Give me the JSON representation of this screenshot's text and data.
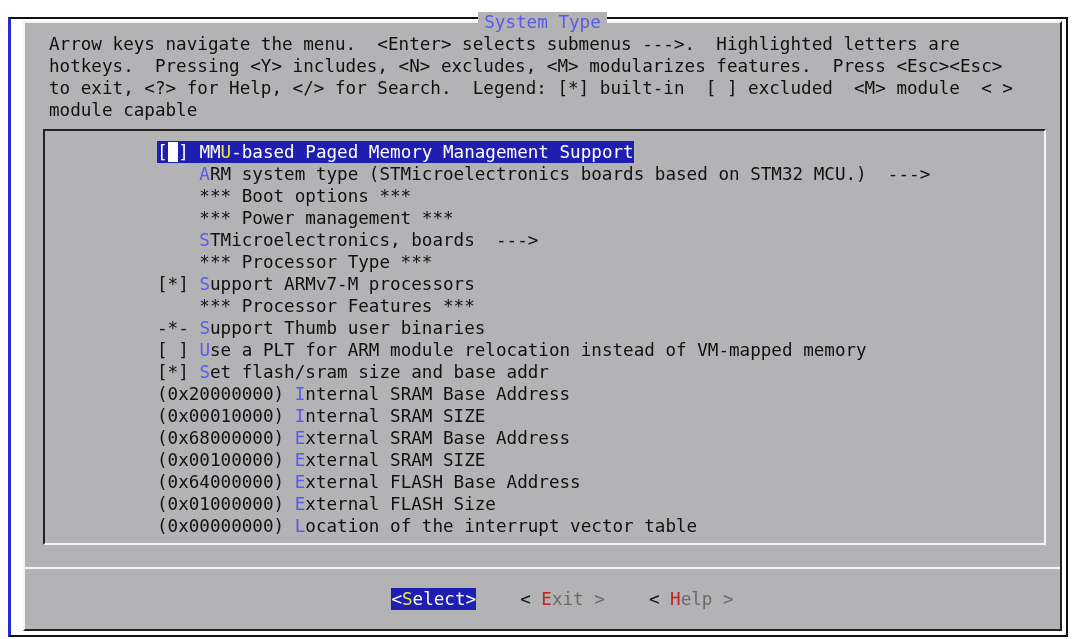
{
  "dialog": {
    "title": "System Type",
    "help_text": [
      "Arrow keys navigate the menu.  <Enter> selects submenus --->.  Highlighted letters are",
      "hotkeys.  Pressing <Y> includes, <N> excludes, <M> modularizes features.  Press <Esc><Esc>",
      "to exit, <?> for Help, </> for Search.  Legend: [*] built-in  [ ] excluded  <M> module  < >",
      "module capable"
    ],
    "menu_items": [
      {
        "marker": "[ ]",
        "before": "MM",
        "hotkey": "U",
        "after": "-based Paged Memory Management Support",
        "selected": true
      },
      {
        "hotkey": "A",
        "after": "RM system type (STMicroelectronics boards based on STM32 MCU.)  --->",
        "selected": false
      },
      {
        "after": "*** Boot options ***",
        "selected": false
      },
      {
        "after": "*** Power management ***",
        "selected": false
      },
      {
        "hotkey": "S",
        "after": "TMicroelectronics, boards  --->",
        "selected": false
      },
      {
        "after": "*** Processor Type ***",
        "selected": false
      },
      {
        "marker": "[*]",
        "hotkey": "S",
        "after": "upport ARMv7-M processors",
        "selected": false
      },
      {
        "after": "*** Processor Features ***",
        "selected": false
      },
      {
        "marker": "-*-",
        "hotkey": "S",
        "after": "upport Thumb user binaries",
        "selected": false
      },
      {
        "marker": "[ ]",
        "hotkey": "U",
        "after": "se a PLT for ARM module relocation instead of VM-mapped memory",
        "selected": false
      },
      {
        "marker": "[*]",
        "hotkey": "S",
        "after": "et flash/sram size and base addr",
        "selected": false
      },
      {
        "marker": "(0x20000000)",
        "hotkey": "I",
        "after": "nternal SRAM Base Address",
        "selected": false
      },
      {
        "marker": "(0x00010000)",
        "hotkey": "I",
        "after": "nternal SRAM SIZE",
        "selected": false
      },
      {
        "marker": "(0x68000000)",
        "hotkey": "E",
        "after": "xternal SRAM Base Address",
        "selected": false
      },
      {
        "marker": "(0x00100000)",
        "hotkey": "E",
        "after": "xternal SRAM SIZE",
        "selected": false
      },
      {
        "marker": "(0x64000000)",
        "hotkey": "E",
        "after": "xternal FLASH Base Address",
        "selected": false
      },
      {
        "marker": "(0x01000000)",
        "hotkey": "E",
        "after": "xternal FLASH Size",
        "selected": false
      },
      {
        "marker": "(0x00000000)",
        "hotkey": "L",
        "after": "ocation of the interrupt vector table",
        "selected": false
      }
    ],
    "buttons": [
      {
        "before": "<",
        "hotkey": "S",
        "after": "elect>",
        "selected": true
      },
      {
        "before": "< ",
        "hotkey": "E",
        "after": "xit >",
        "selected": false
      },
      {
        "before": "< ",
        "hotkey": "H",
        "after": "elp >",
        "selected": false
      }
    ]
  }
}
